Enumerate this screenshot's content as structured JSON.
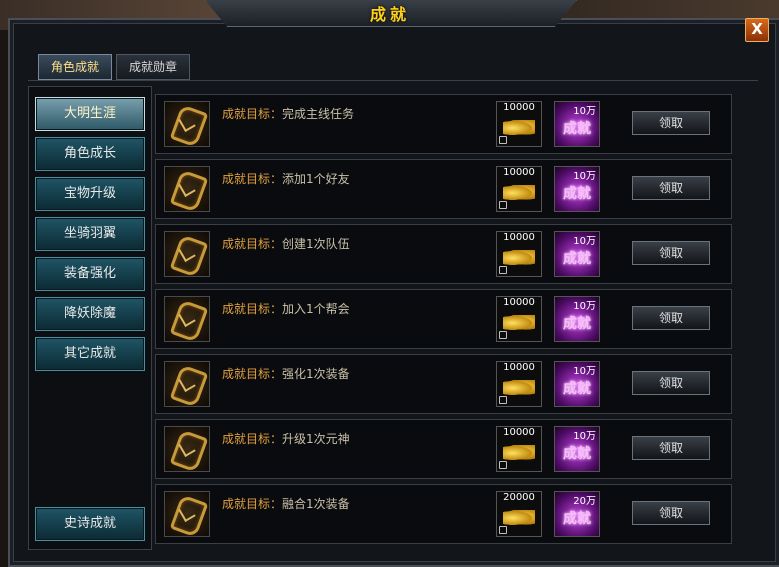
{
  "window": {
    "title": "成就",
    "close_label": "X"
  },
  "tabs": [
    {
      "label": "角色成就",
      "active": true
    },
    {
      "label": "成就勋章",
      "active": false
    }
  ],
  "categories": [
    {
      "label": "大明生涯",
      "active": true
    },
    {
      "label": "角色成长",
      "active": false
    },
    {
      "label": "宝物升级",
      "active": false
    },
    {
      "label": "坐骑羽翼",
      "active": false
    },
    {
      "label": "装备强化",
      "active": false
    },
    {
      "label": "降妖除魔",
      "active": false
    },
    {
      "label": "其它成就",
      "active": false
    }
  ],
  "epic_button": {
    "label": "史诗成就"
  },
  "achievement_prefix": "成就目标：",
  "achievements": [
    {
      "goal": "完成主线任务",
      "gold": "10000",
      "points": "10万",
      "points_label": "成就",
      "claim": "领取"
    },
    {
      "goal": "添加1个好友",
      "gold": "10000",
      "points": "10万",
      "points_label": "成就",
      "claim": "领取"
    },
    {
      "goal": "创建1次队伍",
      "gold": "10000",
      "points": "10万",
      "points_label": "成就",
      "claim": "领取"
    },
    {
      "goal": "加入1个帮会",
      "gold": "10000",
      "points": "10万",
      "points_label": "成就",
      "claim": "领取"
    },
    {
      "goal": "强化1次装备",
      "gold": "10000",
      "points": "10万",
      "points_label": "成就",
      "claim": "领取"
    },
    {
      "goal": "升级1次元神",
      "gold": "10000",
      "points": "10万",
      "points_label": "成就",
      "claim": "领取"
    },
    {
      "goal": "融合1次装备",
      "gold": "20000",
      "points": "20万",
      "points_label": "成就",
      "claim": "领取"
    }
  ],
  "colors": {
    "title": "#ffd21a",
    "goal_prefix": "#e0a040",
    "close_button": "#d86a1a"
  }
}
